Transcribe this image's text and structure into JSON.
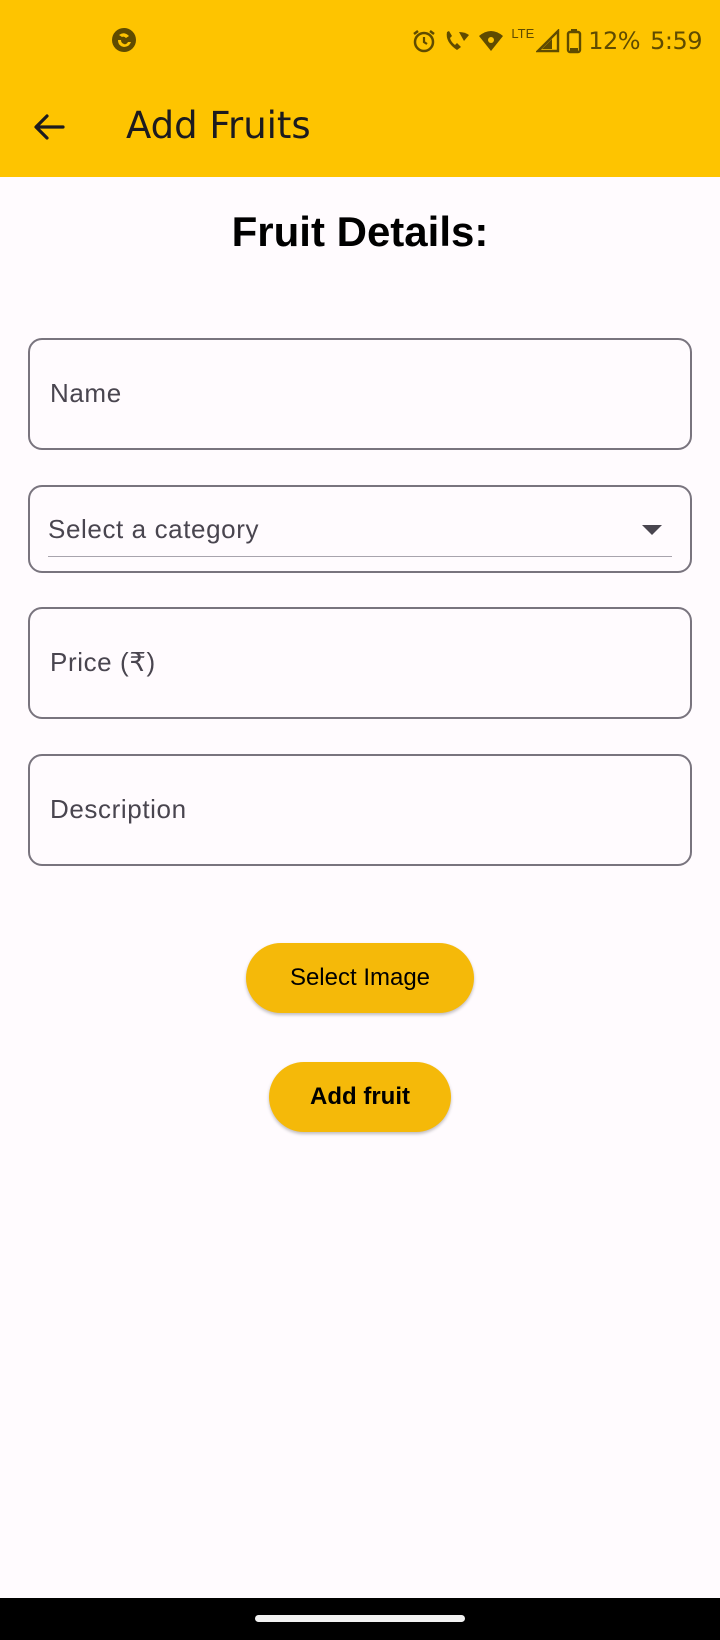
{
  "status_bar": {
    "icons": [
      "app-notification-icon",
      "alarm-icon",
      "wifi-call-icon",
      "wifi-icon",
      "lte-signal-icon",
      "battery-icon"
    ],
    "lte_label": "LTE",
    "battery_percent": "12%",
    "time": "5:59"
  },
  "app_bar": {
    "title": "Add Fruits",
    "back_icon": "arrow-left-icon",
    "color": "#fec400"
  },
  "form": {
    "heading": "Fruit Details:",
    "name_label": "Name",
    "category_placeholder": "Select a category",
    "price_label": "Price (₹)",
    "description_label": "Description",
    "select_image_label": "Select Image",
    "add_fruit_label": "Add fruit",
    "button_color": "#f5b909"
  }
}
